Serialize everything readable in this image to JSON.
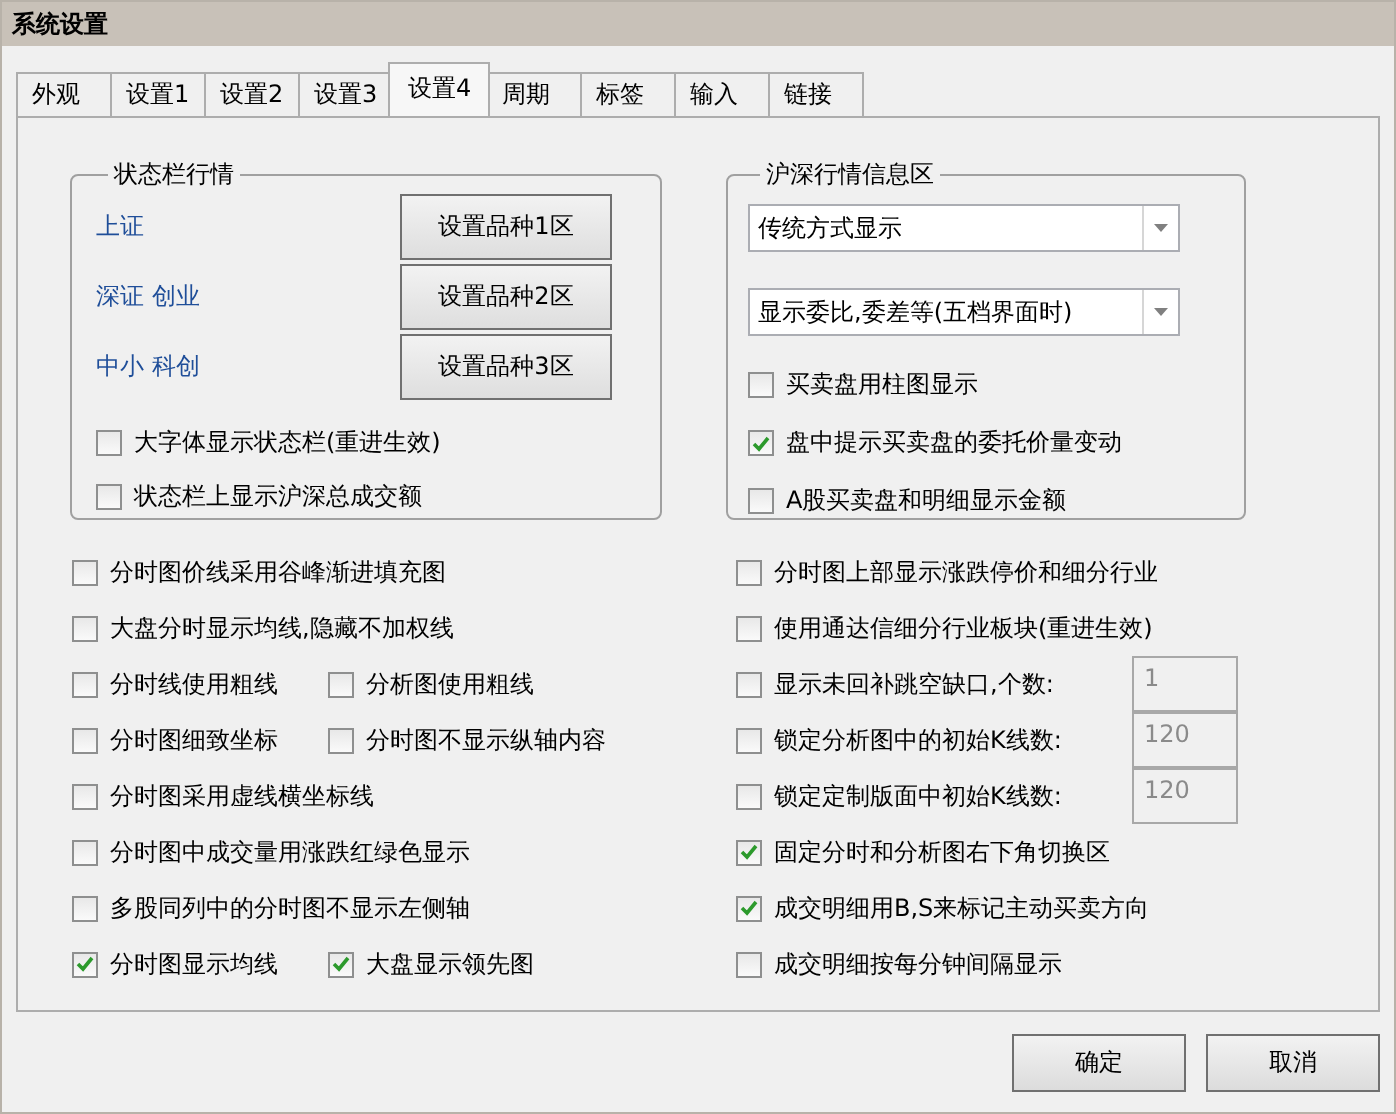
{
  "window": {
    "title": "系统设置"
  },
  "tabs": [
    {
      "label": "外观",
      "selected": false
    },
    {
      "label": "设置1",
      "selected": false
    },
    {
      "label": "设置2",
      "selected": false
    },
    {
      "label": "设置3",
      "selected": false
    },
    {
      "label": "设置4",
      "selected": true
    },
    {
      "label": "周期",
      "selected": false
    },
    {
      "label": "标签",
      "selected": false
    },
    {
      "label": "输入",
      "selected": false
    },
    {
      "label": "链接",
      "selected": false
    }
  ],
  "status_group": {
    "title": "状态栏行情",
    "rows": [
      {
        "label": "上证",
        "button": "设置品种1区"
      },
      {
        "label": "深证 创业",
        "button": "设置品种2区"
      },
      {
        "label": "中小 科创",
        "button": "设置品种3区"
      }
    ],
    "checkboxes": [
      {
        "label": "大字体显示状态栏(重进生效)",
        "checked": false
      },
      {
        "label": "状态栏上显示沪深总成交额",
        "checked": false
      }
    ]
  },
  "market_group": {
    "title": "沪深行情信息区",
    "dropdowns": [
      {
        "value": "传统方式显示"
      },
      {
        "value": "显示委比,委差等(五档界面时)"
      }
    ],
    "checkboxes": [
      {
        "label": "买卖盘用柱图显示",
        "checked": false
      },
      {
        "label": "盘中提示买卖盘的委托价量变动",
        "checked": true
      },
      {
        "label": "A股买卖盘和明细显示金额",
        "checked": false
      }
    ]
  },
  "left_options": [
    [
      {
        "label": "分时图价线采用谷峰渐进填充图",
        "checked": false
      }
    ],
    [
      {
        "label": "大盘分时显示均线,隐藏不加权线",
        "checked": false
      }
    ],
    [
      {
        "label": "分时线使用粗线",
        "checked": false
      },
      {
        "label": "分析图使用粗线",
        "checked": false
      }
    ],
    [
      {
        "label": "分时图细致坐标",
        "checked": false
      },
      {
        "label": "分时图不显示纵轴内容",
        "checked": false
      }
    ],
    [
      {
        "label": "分时图采用虚线横坐标线",
        "checked": false
      }
    ],
    [
      {
        "label": "分时图中成交量用涨跌红绿色显示",
        "checked": false
      }
    ],
    [
      {
        "label": "多股同列中的分时图不显示左侧轴",
        "checked": false
      }
    ],
    [
      {
        "label": "分时图显示均线",
        "checked": true
      },
      {
        "label": "大盘显示领先图",
        "checked": true
      }
    ]
  ],
  "right_options": [
    {
      "kind": "check",
      "label": "分时图上部显示涨跌停价和细分行业",
      "checked": false
    },
    {
      "kind": "check",
      "label": "使用通达信细分行业板块(重进生效)",
      "checked": false
    },
    {
      "kind": "count",
      "label": "显示未回补跳空缺口,个数:",
      "checked": false,
      "value": "1",
      "disabled": true
    },
    {
      "kind": "count",
      "label": "锁定分析图中的初始K线数:",
      "checked": false,
      "value": "120",
      "disabled": true
    },
    {
      "kind": "count",
      "label": "锁定定制版面中初始K线数:",
      "checked": false,
      "value": "120",
      "disabled": true
    },
    {
      "kind": "check",
      "label": "固定分时和分析图右下角切换区",
      "checked": true
    },
    {
      "kind": "check",
      "label": "成交明细用B,S来标记主动买卖方向",
      "checked": true
    },
    {
      "kind": "check",
      "label": "成交明细按每分钟间隔显示",
      "checked": false
    }
  ],
  "buttons": [
    {
      "label": "确定"
    },
    {
      "label": "取消"
    }
  ]
}
